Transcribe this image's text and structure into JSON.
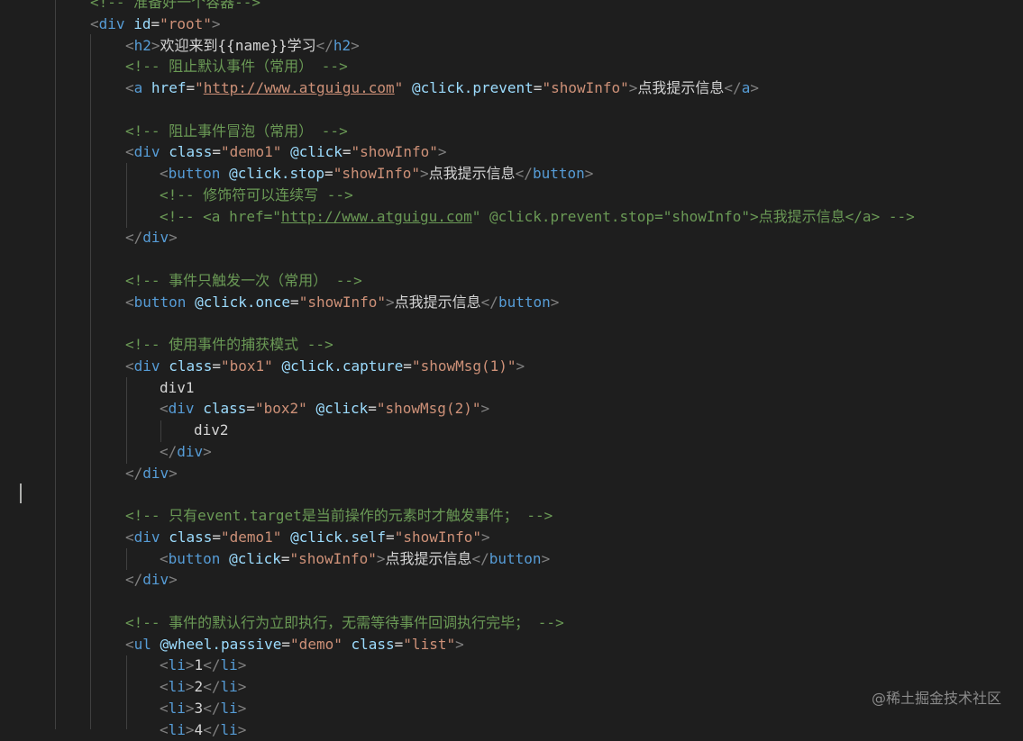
{
  "editor": {
    "lines": [
      [
        [
          "cmt",
          "<!-- 准备好一个容器-->"
        ]
      ],
      [
        [
          "punc",
          "<"
        ],
        [
          "tag",
          "div"
        ],
        [
          "txt",
          " "
        ],
        [
          "attr",
          "id"
        ],
        [
          "txt",
          "="
        ],
        [
          "str",
          "\"root\""
        ],
        [
          "punc",
          ">"
        ]
      ],
      [
        [
          "punc",
          "<"
        ],
        [
          "tag",
          "h2"
        ],
        [
          "punc",
          ">"
        ],
        [
          "txt",
          "欢迎来到{{name}}学习"
        ],
        [
          "punc",
          "</"
        ],
        [
          "tag",
          "h2"
        ],
        [
          "punc",
          ">"
        ]
      ],
      [
        [
          "cmt",
          "<!-- 阻止默认事件（常用） -->"
        ]
      ],
      [
        [
          "punc",
          "<"
        ],
        [
          "tag",
          "a"
        ],
        [
          "txt",
          " "
        ],
        [
          "attr",
          "href"
        ],
        [
          "txt",
          "="
        ],
        [
          "str",
          "\""
        ],
        [
          "url",
          "http://www.atguigu.com"
        ],
        [
          "str",
          "\""
        ],
        [
          "txt",
          " "
        ],
        [
          "attr",
          "@click.prevent"
        ],
        [
          "txt",
          "="
        ],
        [
          "str",
          "\"showInfo\""
        ],
        [
          "punc",
          ">"
        ],
        [
          "txt",
          "点我提示信息"
        ],
        [
          "punc",
          "</"
        ],
        [
          "tag",
          "a"
        ],
        [
          "punc",
          ">"
        ]
      ],
      [],
      [
        [
          "cmt",
          "<!-- 阻止事件冒泡（常用） -->"
        ]
      ],
      [
        [
          "punc",
          "<"
        ],
        [
          "tag",
          "div"
        ],
        [
          "txt",
          " "
        ],
        [
          "attr",
          "class"
        ],
        [
          "txt",
          "="
        ],
        [
          "str",
          "\"demo1\""
        ],
        [
          "txt",
          " "
        ],
        [
          "attr",
          "@click"
        ],
        [
          "txt",
          "="
        ],
        [
          "str",
          "\"showInfo\""
        ],
        [
          "punc",
          ">"
        ]
      ],
      [
        [
          "punc",
          "<"
        ],
        [
          "tag",
          "button"
        ],
        [
          "txt",
          " "
        ],
        [
          "attr",
          "@click.stop"
        ],
        [
          "txt",
          "="
        ],
        [
          "str",
          "\"showInfo\""
        ],
        [
          "punc",
          ">"
        ],
        [
          "txt",
          "点我提示信息"
        ],
        [
          "punc",
          "</"
        ],
        [
          "tag",
          "button"
        ],
        [
          "punc",
          ">"
        ]
      ],
      [
        [
          "cmt",
          "<!-- 修饰符可以连续写 -->"
        ]
      ],
      [
        [
          "cmt",
          "<!-- <a href=\""
        ],
        [
          "cmturl",
          "http://www.atguigu.com"
        ],
        [
          "cmt",
          "\" @click.prevent.stop=\"showInfo\">点我提示信息</a> -->"
        ]
      ],
      [
        [
          "punc",
          "</"
        ],
        [
          "tag",
          "div"
        ],
        [
          "punc",
          ">"
        ]
      ],
      [],
      [
        [
          "cmt",
          "<!-- 事件只触发一次（常用） -->"
        ]
      ],
      [
        [
          "punc",
          "<"
        ],
        [
          "tag",
          "button"
        ],
        [
          "txt",
          " "
        ],
        [
          "attr",
          "@click.once"
        ],
        [
          "txt",
          "="
        ],
        [
          "str",
          "\"showInfo\""
        ],
        [
          "punc",
          ">"
        ],
        [
          "txt",
          "点我提示信息"
        ],
        [
          "punc",
          "</"
        ],
        [
          "tag",
          "button"
        ],
        [
          "punc",
          ">"
        ]
      ],
      [],
      [
        [
          "cmt",
          "<!-- 使用事件的捕获模式 -->"
        ]
      ],
      [
        [
          "punc",
          "<"
        ],
        [
          "tag",
          "div"
        ],
        [
          "txt",
          " "
        ],
        [
          "attr",
          "class"
        ],
        [
          "txt",
          "="
        ],
        [
          "str",
          "\"box1\""
        ],
        [
          "txt",
          " "
        ],
        [
          "attr",
          "@click.capture"
        ],
        [
          "txt",
          "="
        ],
        [
          "str",
          "\"showMsg(1)\""
        ],
        [
          "punc",
          ">"
        ]
      ],
      [
        [
          "txt",
          "div1"
        ]
      ],
      [
        [
          "punc",
          "<"
        ],
        [
          "tag",
          "div"
        ],
        [
          "txt",
          " "
        ],
        [
          "attr",
          "class"
        ],
        [
          "txt",
          "="
        ],
        [
          "str",
          "\"box2\""
        ],
        [
          "txt",
          " "
        ],
        [
          "attr",
          "@click"
        ],
        [
          "txt",
          "="
        ],
        [
          "str",
          "\"showMsg(2)\""
        ],
        [
          "punc",
          ">"
        ]
      ],
      [
        [
          "txt",
          "div2"
        ]
      ],
      [
        [
          "punc",
          "</"
        ],
        [
          "tag",
          "div"
        ],
        [
          "punc",
          ">"
        ]
      ],
      [
        [
          "punc",
          "</"
        ],
        [
          "tag",
          "div"
        ],
        [
          "punc",
          ">"
        ]
      ],
      [],
      [
        [
          "cmt",
          "<!-- 只有event.target是当前操作的元素时才触发事件； -->"
        ]
      ],
      [
        [
          "punc",
          "<"
        ],
        [
          "tag",
          "div"
        ],
        [
          "txt",
          " "
        ],
        [
          "attr",
          "class"
        ],
        [
          "txt",
          "="
        ],
        [
          "str",
          "\"demo1\""
        ],
        [
          "txt",
          " "
        ],
        [
          "attr",
          "@click.self"
        ],
        [
          "txt",
          "="
        ],
        [
          "str",
          "\"showInfo\""
        ],
        [
          "punc",
          ">"
        ]
      ],
      [
        [
          "punc",
          "<"
        ],
        [
          "tag",
          "button"
        ],
        [
          "txt",
          " "
        ],
        [
          "attr",
          "@click"
        ],
        [
          "txt",
          "="
        ],
        [
          "str",
          "\"showInfo\""
        ],
        [
          "punc",
          ">"
        ],
        [
          "txt",
          "点我提示信息"
        ],
        [
          "punc",
          "</"
        ],
        [
          "tag",
          "button"
        ],
        [
          "punc",
          ">"
        ]
      ],
      [
        [
          "punc",
          "</"
        ],
        [
          "tag",
          "div"
        ],
        [
          "punc",
          ">"
        ]
      ],
      [],
      [
        [
          "cmt",
          "<!-- 事件的默认行为立即执行，无需等待事件回调执行完毕； -->"
        ]
      ],
      [
        [
          "punc",
          "<"
        ],
        [
          "tag",
          "ul"
        ],
        [
          "txt",
          " "
        ],
        [
          "attr",
          "@wheel.passive"
        ],
        [
          "txt",
          "="
        ],
        [
          "str",
          "\"demo\""
        ],
        [
          "txt",
          " "
        ],
        [
          "attr",
          "class"
        ],
        [
          "txt",
          "="
        ],
        [
          "str",
          "\"list\""
        ],
        [
          "punc",
          ">"
        ]
      ],
      [
        [
          "punc",
          "<"
        ],
        [
          "tag",
          "li"
        ],
        [
          "punc",
          ">"
        ],
        [
          "txt",
          "1"
        ],
        [
          "punc",
          "</"
        ],
        [
          "tag",
          "li"
        ],
        [
          "punc",
          ">"
        ]
      ],
      [
        [
          "punc",
          "<"
        ],
        [
          "tag",
          "li"
        ],
        [
          "punc",
          ">"
        ],
        [
          "txt",
          "2"
        ],
        [
          "punc",
          "</"
        ],
        [
          "tag",
          "li"
        ],
        [
          "punc",
          ">"
        ]
      ],
      [
        [
          "punc",
          "<"
        ],
        [
          "tag",
          "li"
        ],
        [
          "punc",
          ">"
        ],
        [
          "txt",
          "3"
        ],
        [
          "punc",
          "</"
        ],
        [
          "tag",
          "li"
        ],
        [
          "punc",
          ">"
        ]
      ],
      [
        [
          "punc",
          "<"
        ],
        [
          "tag",
          "li"
        ],
        [
          "punc",
          ">"
        ],
        [
          "txt",
          "4"
        ],
        [
          "punc",
          "</"
        ],
        [
          "tag",
          "li"
        ],
        [
          "punc",
          ">"
        ]
      ]
    ]
  },
  "watermark": "@稀土掘金技术社区"
}
